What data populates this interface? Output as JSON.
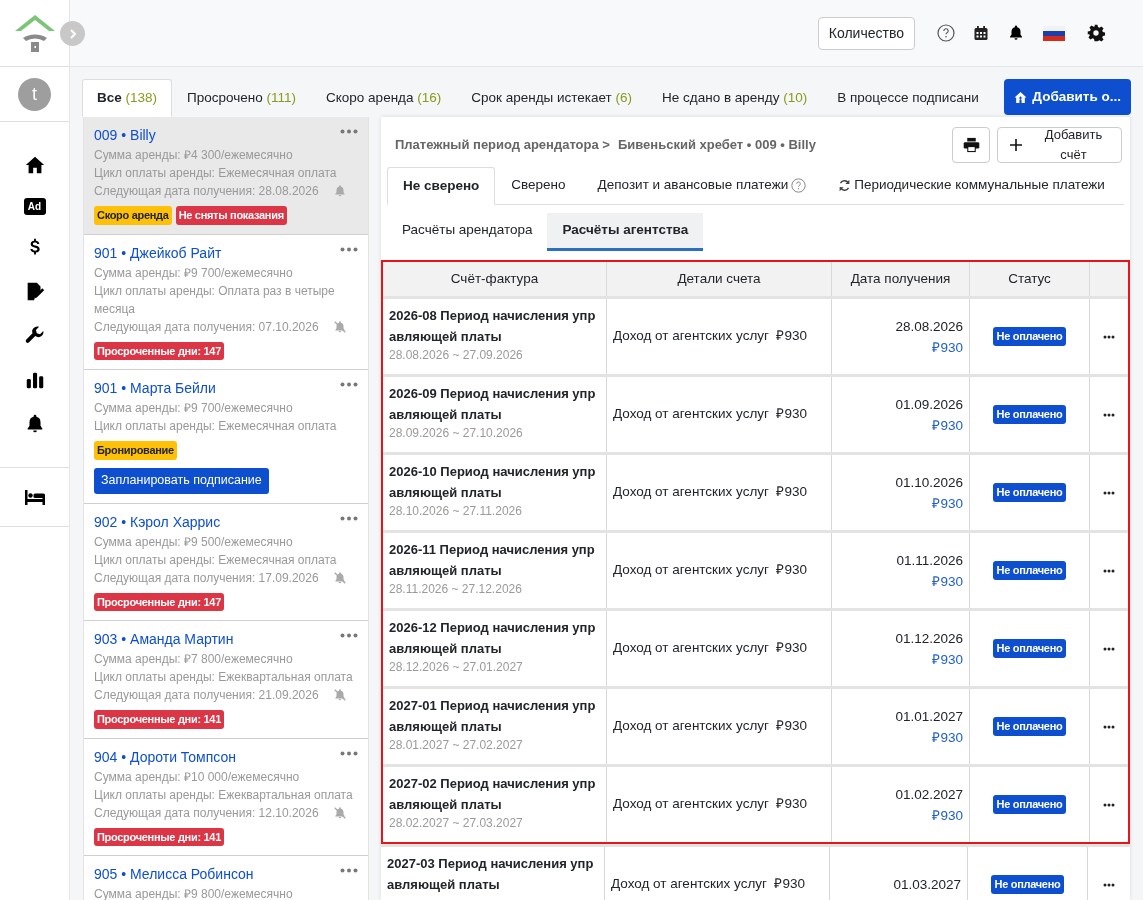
{
  "header": {
    "quantity_button": "Количество"
  },
  "rail": {
    "avatar": "t",
    "nav": [
      {
        "kind": "home"
      },
      {
        "kind": "ad",
        "text": "Ad"
      },
      {
        "kind": "dollar"
      },
      {
        "kind": "sign"
      },
      {
        "kind": "wrench"
      },
      {
        "kind": "chart"
      },
      {
        "kind": "bell"
      }
    ],
    "bottom": [
      {
        "kind": "bed"
      }
    ]
  },
  "tabs": [
    {
      "label": "Все",
      "count": "(138)",
      "selected": true
    },
    {
      "label": "Просрочено",
      "count": "(111)",
      "selected": false
    },
    {
      "label": "Скоро аренда",
      "count": "(16)",
      "selected": false
    },
    {
      "label": "Срок аренды истекает",
      "count": "(6)",
      "selected": false
    },
    {
      "label": "Не сдано в аренду",
      "count": "(10)",
      "selected": false
    },
    {
      "label": "В процессе подписани",
      "selected": false
    }
  ],
  "add_button": "Добавить о...",
  "cards": [
    {
      "title": "009 • Billy",
      "selected": true,
      "lines": [
        "Сумма аренды: ₽4 300/ежемесячно",
        "Цикл оплаты аренды: Ежемесячная оплата"
      ],
      "next_label": "Следующая дата получения:",
      "next_date": "28.08.2026",
      "muted": false,
      "tags": [
        {
          "text": "Скоро аренда",
          "kind": "warning"
        },
        {
          "text": "Не сняты показания",
          "kind": "danger"
        }
      ]
    },
    {
      "title": "901 • Джейкоб Райт",
      "selected": false,
      "lines": [
        "Сумма аренды: ₽9 700/ежемесячно",
        "Цикл оплаты аренды: Оплата раз в четыре месяца"
      ],
      "next_label": "Следующая дата получения:",
      "next_date": "07.10.2026",
      "muted": true,
      "tags": [
        {
          "text": "Просроченные дни: 147",
          "kind": "danger"
        }
      ]
    },
    {
      "title": "901 • Марта Бейли",
      "selected": false,
      "lines": [
        "Сумма аренды: ₽9 700/ежемесячно",
        "Цикл оплаты аренды: Ежемесячная оплата"
      ],
      "tags": [
        {
          "text": "Бронирование",
          "kind": "warning"
        }
      ],
      "button": "Запланировать подписание"
    },
    {
      "title": "902 • Кэрол Харрис",
      "selected": false,
      "lines": [
        "Сумма аренды: ₽9 500/ежемесячно",
        "Цикл оплаты аренды: Ежемесячная оплата"
      ],
      "next_label": "Следующая дата получения:",
      "next_date": "17.09.2026",
      "muted": true,
      "tags": [
        {
          "text": "Просроченные дни: 147",
          "kind": "danger"
        }
      ]
    },
    {
      "title": "903 • Аманда Мартин",
      "selected": false,
      "lines": [
        "Сумма аренды: ₽7 800/ежемесячно",
        "Цикл оплаты аренды: Ежеквартальная оплата"
      ],
      "next_label": "Следующая дата получения:",
      "next_date": "21.09.2026",
      "muted": true,
      "tags": [
        {
          "text": "Просроченные дни: 141",
          "kind": "danger"
        }
      ]
    },
    {
      "title": "904 • Дороти Томпсон",
      "selected": false,
      "lines": [
        "Сумма аренды: ₽10 000/ежемесячно",
        "Цикл оплаты аренды: Ежеквартальная оплата"
      ],
      "next_label": "Следующая дата получения:",
      "next_date": "12.10.2026",
      "muted": true,
      "tags": [
        {
          "text": "Просроченные дни: 141",
          "kind": "danger"
        }
      ]
    },
    {
      "title": "905 • Мелисса Робинсон",
      "selected": false,
      "lines": [
        "Сумма аренды: ₽9 800/ежемесячно"
      ]
    }
  ],
  "panel": {
    "breadcrumb": [
      "Платежный период арендатора >",
      "Бивеньский хребет • 009 • Billy"
    ],
    "add_invoice": "Добавить счёт",
    "tabs": [
      {
        "label": "Не сверено",
        "selected": true,
        "kind": "plain"
      },
      {
        "label": "Сверено",
        "selected": false,
        "kind": "plain"
      },
      {
        "label": "Депозит и авансовые платежи",
        "selected": false,
        "kind": "help"
      },
      {
        "label": "Периодические коммунальные платежи",
        "selected": false,
        "kind": "refresh"
      }
    ],
    "subtabs": [
      {
        "label": "Расчёты арендатора",
        "selected": false
      },
      {
        "label": "Расчёты агентства",
        "selected": true
      }
    ],
    "table": {
      "columns": [
        "Счёт-фактура",
        "Детали счета",
        "Дата получения",
        "Статус"
      ],
      "rows": [
        {
          "title": "2026-08 Период начисления управляющей платы",
          "period": "28.08.2026 ~ 27.09.2026",
          "details": "Доход от агентских услуг  ₽930",
          "date": "28.08.2026",
          "amount": "₽930",
          "status": "Не оплачено",
          "highlighted": true
        },
        {
          "title": "2026-09 Период начисления управляющей платы",
          "period": "28.09.2026 ~ 27.10.2026",
          "details": "Доход от агентских услуг  ₽930",
          "date": "01.09.2026",
          "amount": "₽930",
          "status": "Не оплачено",
          "highlighted": true
        },
        {
          "title": "2026-10 Период начисления управляющей платы",
          "period": "28.10.2026 ~ 27.11.2026",
          "details": "Доход от агентских услуг  ₽930",
          "date": "01.10.2026",
          "amount": "₽930",
          "status": "Не оплачено",
          "highlighted": true
        },
        {
          "title": "2026-11 Период начисления управляющей платы",
          "period": "28.11.2026 ~ 27.12.2026",
          "details": "Доход от агентских услуг  ₽930",
          "date": "01.11.2026",
          "amount": "₽930",
          "status": "Не оплачено",
          "highlighted": true
        },
        {
          "title": "2026-12 Период начисления управляющей платы",
          "period": "28.12.2026 ~ 27.01.2027",
          "details": "Доход от агентских услуг  ₽930",
          "date": "01.12.2026",
          "amount": "₽930",
          "status": "Не оплачено",
          "highlighted": true
        },
        {
          "title": "2027-01 Период начисления управляющей платы",
          "period": "28.01.2027 ~ 27.02.2027",
          "details": "Доход от агентских услуг  ₽930",
          "date": "01.01.2027",
          "amount": "₽930",
          "status": "Не оплачено",
          "highlighted": true
        },
        {
          "title": "2027-02 Период начисления управляющей платы",
          "period": "28.02.2027 ~ 27.03.2027",
          "details": "Доход от агентских услуг  ₽930",
          "date": "01.02.2027",
          "amount": "₽930",
          "status": "Не оплачено",
          "highlighted": true
        },
        {
          "title": "2027-03 Период начисления управляющей платы",
          "details": "Доход от агентских услуг  ₽930",
          "date": "01.03.2027",
          "status": "Не оплачено",
          "highlighted": false
        }
      ]
    }
  }
}
